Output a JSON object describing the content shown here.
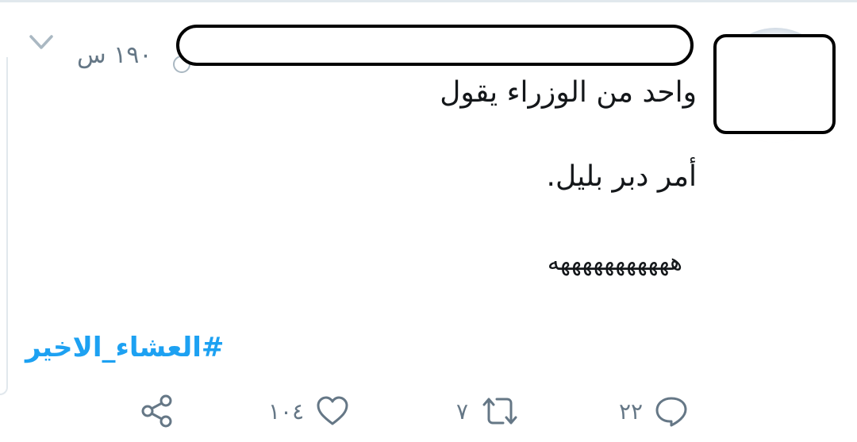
{
  "tweet": {
    "time": "١٩٠ س",
    "lines": [
      "واحد من الوزراء يقول",
      "أمر دبر بليل.",
      "هههههههههههه"
    ],
    "hashtag": "#العشاء_الاخير"
  },
  "actions": {
    "replies": "٢٢",
    "retweets": "٧",
    "likes": "١٠٤"
  },
  "colors": {
    "link": "#1da1f2",
    "muted": "#657786",
    "border": "#e1e8ed"
  },
  "icons": {
    "menu": "chevron-down-icon",
    "reply": "comment-icon",
    "retweet": "retweet-icon",
    "like": "heart-icon",
    "share": "share-icon"
  }
}
